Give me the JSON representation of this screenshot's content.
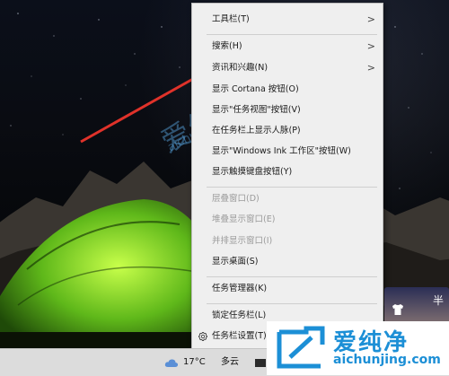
{
  "context_menu": {
    "items": [
      {
        "label": "工具栏(T)",
        "has_submenu": true,
        "enabled": true
      },
      {
        "label": "搜索(H)",
        "has_submenu": true,
        "enabled": true
      },
      {
        "label": "资讯和兴趣(N)",
        "has_submenu": true,
        "enabled": true
      },
      {
        "label": "显示 Cortana 按钮(O)",
        "has_submenu": false,
        "enabled": true
      },
      {
        "label": "显示\"任务视图\"按钮(V)",
        "has_submenu": false,
        "enabled": true
      },
      {
        "label": "在任务栏上显示人脉(P)",
        "has_submenu": false,
        "enabled": true
      },
      {
        "label": "显示\"Windows Ink 工作区\"按钮(W)",
        "has_submenu": false,
        "enabled": true
      },
      {
        "label": "显示触摸键盘按钮(Y)",
        "has_submenu": false,
        "enabled": true
      },
      {
        "label": "层叠窗口(D)",
        "has_submenu": false,
        "enabled": false
      },
      {
        "label": "堆叠显示窗口(E)",
        "has_submenu": false,
        "enabled": false
      },
      {
        "label": "并排显示窗口(I)",
        "has_submenu": false,
        "enabled": false
      },
      {
        "label": "显示桌面(S)",
        "has_submenu": false,
        "enabled": true
      },
      {
        "label": "任务管理器(K)",
        "has_submenu": false,
        "enabled": true
      },
      {
        "label": "锁定任务栏(L)",
        "has_submenu": false,
        "enabled": true
      },
      {
        "label": "任务栏设置(T)",
        "has_submenu": false,
        "enabled": true,
        "icon": "gear-icon"
      }
    ],
    "arrow_glyph": ">"
  },
  "taskbar": {
    "weather": {
      "temperature": "17°C",
      "description": "多云",
      "icon": "cloud-icon"
    }
  },
  "widget": {
    "text": "半"
  },
  "watermark": {
    "desktop_cn": "爱纯净",
    "desktop_en": "aichunjing.com",
    "logo_cn": "爱纯净",
    "logo_en": "aichunjing.com"
  },
  "colors": {
    "annotation_arrow": "#e0322a",
    "watermark_blue": "#1c8fd6",
    "menu_background": "#efefef",
    "taskbar_background": "#dcdcdc"
  }
}
